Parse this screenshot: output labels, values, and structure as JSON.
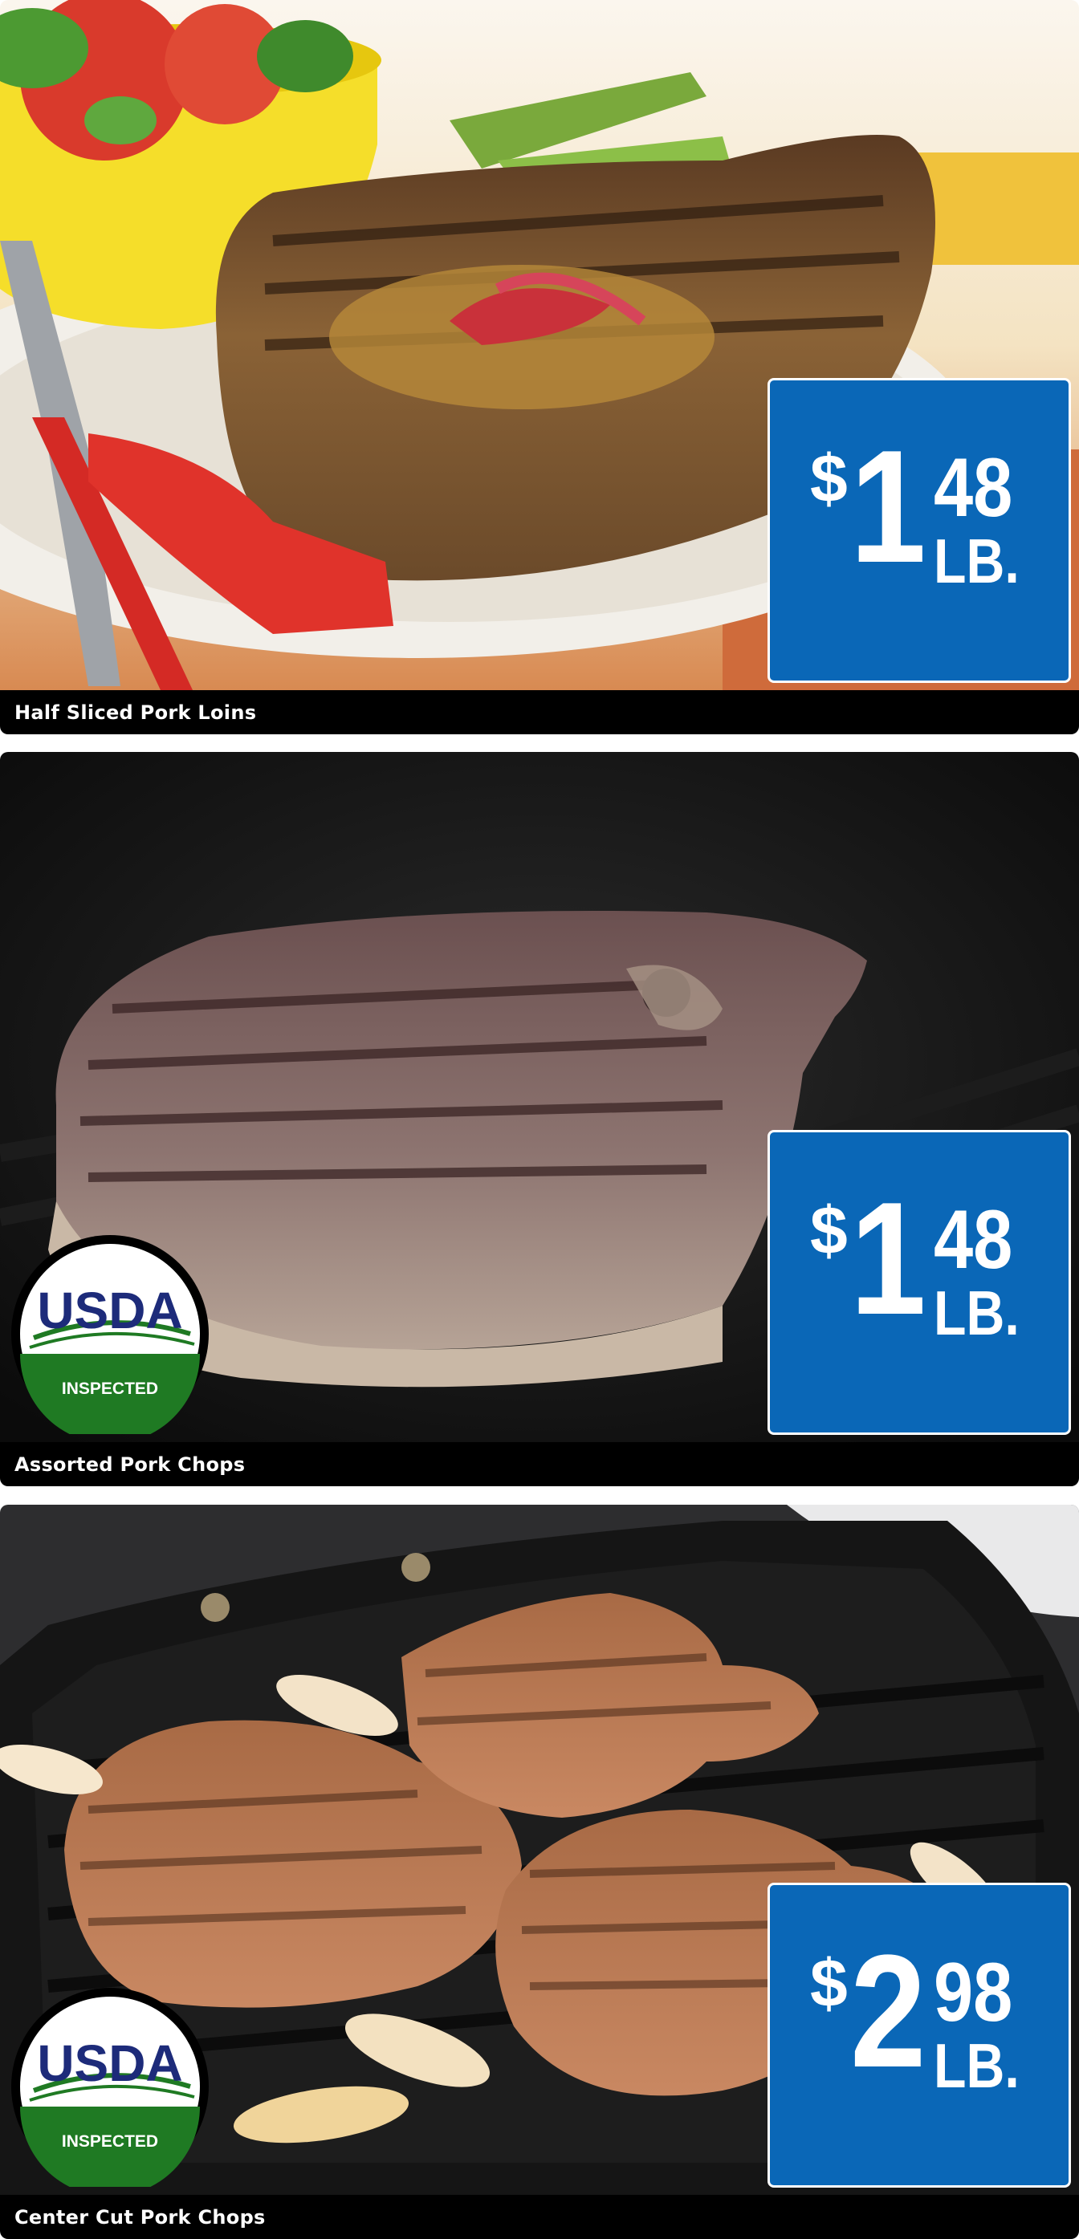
{
  "colors": {
    "price_box": "#0a67b7",
    "caption_bar": "#000000",
    "usda_navy": "#1d2b7a",
    "usda_green": "#1f7a23"
  },
  "products": [
    {
      "name": "Half Sliced Pork Loins",
      "price": {
        "currency": "$",
        "whole": "1",
        "cents": "48",
        "unit": "LB."
      },
      "usda_badge": false
    },
    {
      "name": "Assorted Pork Chops",
      "price": {
        "currency": "$",
        "whole": "1",
        "cents": "48",
        "unit": "LB."
      },
      "usda_badge": true
    },
    {
      "name": "Center Cut Pork Chops",
      "price": {
        "currency": "$",
        "whole": "2",
        "cents": "98",
        "unit": "LB."
      },
      "usda_badge": true
    }
  ],
  "usda": {
    "title": "USDA",
    "subtitle": "INSPECTED"
  }
}
